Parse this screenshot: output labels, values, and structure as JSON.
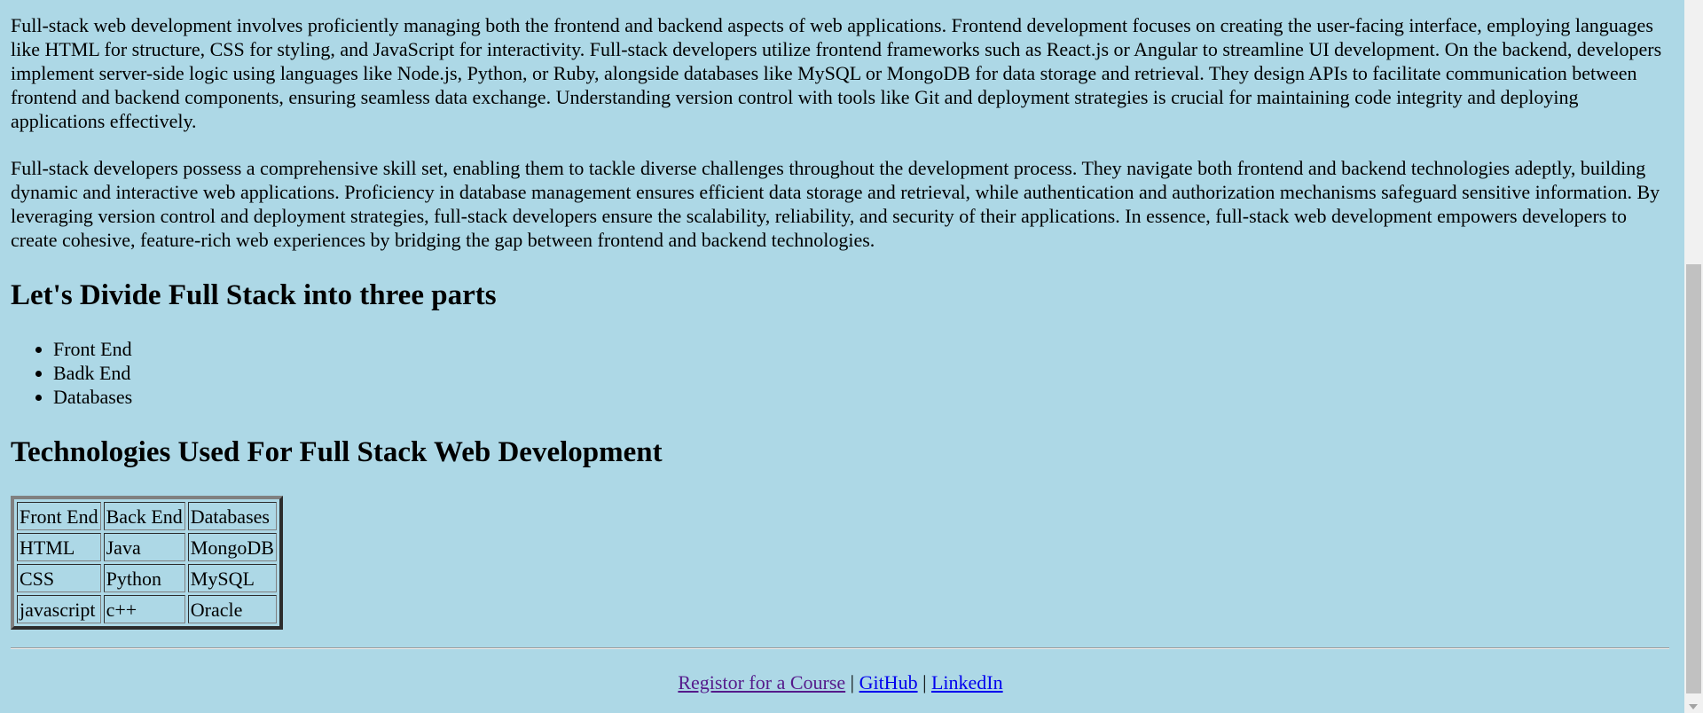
{
  "paragraphs": [
    "Full-stack web development involves proficiently managing both the frontend and backend aspects of web applications. Frontend development focuses on creating the user-facing interface, employing languages like HTML for structure, CSS for styling, and JavaScript for interactivity. Full-stack developers utilize frontend frameworks such as React.js or Angular to streamline UI development. On the backend, developers implement server-side logic using languages like Node.js, Python, or Ruby, alongside databases like MySQL or MongoDB for data storage and retrieval. They design APIs to facilitate communication between frontend and backend components, ensuring seamless data exchange. Understanding version control with tools like Git and deployment strategies is crucial for maintaining code integrity and deploying applications effectively.",
    "Full-stack developers possess a comprehensive skill set, enabling them to tackle diverse challenges throughout the development process. They navigate both frontend and backend technologies adeptly, building dynamic and interactive web applications. Proficiency in database management ensures efficient data storage and retrieval, while authentication and authorization mechanisms safeguard sensitive information. By leveraging version control and deployment strategies, full-stack developers ensure the scalability, reliability, and security of their applications. In essence, full-stack web development empowers developers to create cohesive, feature-rich web experiences by bridging the gap between frontend and backend technologies."
  ],
  "parts_heading": "Let's Divide Full Stack into three parts",
  "parts": [
    "Front End",
    "Badk End",
    "Databases"
  ],
  "tech_heading": "Technologies Used For Full Stack Web Development",
  "tech_table": {
    "rows": [
      [
        "Front End",
        "Back End",
        "Databases"
      ],
      [
        "HTML",
        "Java",
        "MongoDB"
      ],
      [
        "CSS",
        "Python",
        "MySQL"
      ],
      [
        "javascript",
        "c++",
        "Oracle"
      ]
    ]
  },
  "footer": {
    "register_link": "Registor for a Course",
    "separator": "|",
    "github_link": "GitHub",
    "linkedin_link": "LinkedIn"
  },
  "colors": {
    "background": "#add8e6",
    "link": "#0000ee",
    "visited_link": "#551a8b"
  }
}
